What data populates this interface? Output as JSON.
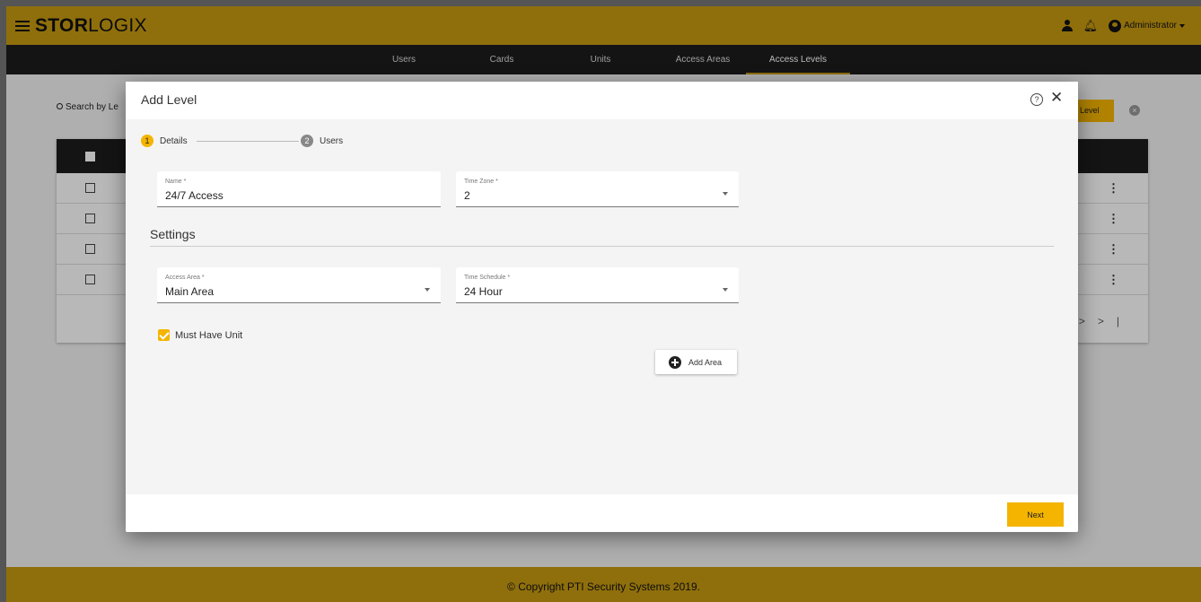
{
  "app": {
    "logo_bold": "STOR",
    "logo_rest": "LOGIX",
    "user_label": "Administrator"
  },
  "nav": {
    "tabs": [
      "Users",
      "Cards",
      "Units",
      "Access Areas",
      "Access Levels"
    ],
    "active": "Access Levels"
  },
  "background": {
    "search_placeholder": "Search by Le",
    "add_level_label": "Level"
  },
  "modal": {
    "title": "Add Level",
    "steps": [
      {
        "number": "1",
        "label": "Details"
      },
      {
        "number": "2",
        "label": "Users"
      }
    ],
    "fields": {
      "name": {
        "label": "Name *",
        "value": "24/7 Access"
      },
      "time_zone": {
        "label": "Time Zone *",
        "value": "2"
      },
      "access_area": {
        "label": "Access Area *",
        "value": "Main Area"
      },
      "time_schedule": {
        "label": "Time Schedule *",
        "value": "24 Hour"
      }
    },
    "settings_title": "Settings",
    "must_have_unit": {
      "label": "Must Have Unit",
      "checked": true
    },
    "add_area_label": "Add Area",
    "next_label": "Next"
  },
  "footer": {
    "copyright": "© Copyright PTI Security Systems 2019."
  },
  "colors": {
    "brand": "#c79a11",
    "accent": "#f4b400",
    "nav_bg": "#1c1c1c"
  }
}
